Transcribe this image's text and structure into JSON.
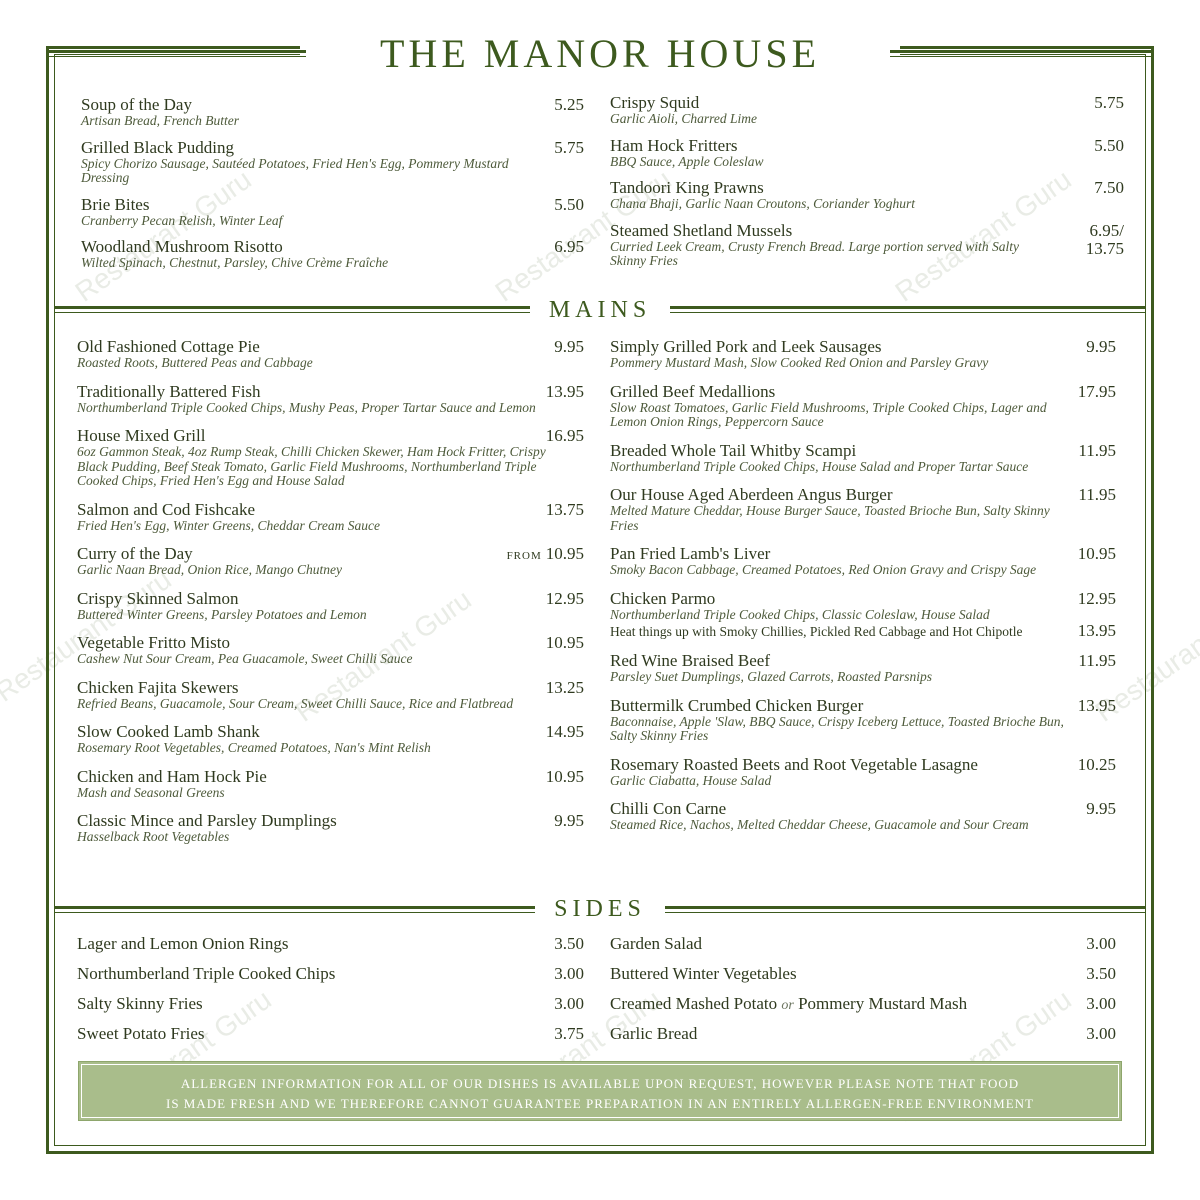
{
  "title": "THE MANOR HOUSE",
  "watermark": "Restaurant Guru",
  "colors": {
    "accent": "#3d5a1e",
    "banner": "#a9bd8b"
  },
  "starters_left": [
    {
      "name": "Soup of the Day",
      "desc": "Artisan Bread, French Butter",
      "price": "5.25"
    },
    {
      "name": "Grilled Black Pudding",
      "desc": "Spicy Chorizo Sausage, Sautéed Potatoes, Fried Hen's Egg, Pommery Mustard Dressing",
      "price": "5.75"
    },
    {
      "name": "Brie Bites",
      "desc": "Cranberry Pecan Relish, Winter Leaf",
      "price": "5.50"
    },
    {
      "name": "Woodland Mushroom Risotto",
      "desc": "Wilted Spinach, Chestnut, Parsley, Chive Crème Fraîche",
      "price": "6.95"
    }
  ],
  "starters_right": [
    {
      "name": "Crispy Squid",
      "desc": "Garlic Aioli, Charred Lime",
      "price": "5.75"
    },
    {
      "name": "Ham Hock Fritters",
      "desc": "BBQ Sauce, Apple Coleslaw",
      "price": "5.50"
    },
    {
      "name": "Tandoori King Prawns",
      "desc": "Chana Bhaji, Garlic Naan Croutons, Coriander Yoghurt",
      "price": "7.50"
    },
    {
      "name": "Steamed Shetland Mussels",
      "desc": "Curried Leek Cream, Crusty French Bread. Large portion served with Salty Skinny Fries",
      "price": "6.95/ 13.75"
    }
  ],
  "mains_heading": "MAINS",
  "mains_left": [
    {
      "name": "Old Fashioned Cottage Pie",
      "desc": "Roasted Roots, Buttered Peas and Cabbage",
      "price": "9.95"
    },
    {
      "name": "Traditionally Battered Fish",
      "desc": "Northumberland Triple Cooked Chips, Mushy Peas, Proper Tartar Sauce and Lemon",
      "price": "13.95"
    },
    {
      "name": "House Mixed Grill",
      "desc": "6oz Gammon Steak, 4oz Rump Steak, Chilli Chicken Skewer, Ham Hock Fritter, Crispy Black Pudding, Beef Steak Tomato, Garlic Field Mushrooms, Northumberland Triple Cooked Chips, Fried Hen's Egg and House Salad",
      "price": "16.95"
    },
    {
      "name": "Salmon and Cod Fishcake",
      "desc": "Fried Hen's Egg, Winter Greens, Cheddar Cream Sauce",
      "price": "13.75"
    },
    {
      "name": "Curry of the Day",
      "desc": "Garlic Naan Bread, Onion Rice, Mango Chutney",
      "price": "10.95",
      "prefix": "FROM"
    },
    {
      "name": "Crispy Skinned Salmon",
      "desc": "Buttered Winter Greens, Parsley Potatoes and Lemon",
      "price": "12.95"
    },
    {
      "name": "Vegetable Fritto Misto",
      "desc": "Cashew Nut Sour Cream, Pea Guacamole, Sweet Chilli Sauce",
      "price": "10.95"
    },
    {
      "name": "Chicken Fajita Skewers",
      "desc": "Refried Beans, Guacamole, Sour Cream, Sweet Chilli Sauce, Rice and Flatbread",
      "price": "13.25"
    },
    {
      "name": "Slow Cooked Lamb Shank",
      "desc": "Rosemary Root Vegetables, Creamed Potatoes, Nan's Mint Relish",
      "price": "14.95"
    },
    {
      "name": "Chicken and Ham Hock Pie",
      "desc": "Mash and Seasonal Greens",
      "price": "10.95"
    },
    {
      "name": "Classic Mince and Parsley Dumplings",
      "desc": "Hasselback Root Vegetables",
      "price": "9.95"
    }
  ],
  "mains_right": [
    {
      "name": "Simply Grilled Pork and Leek Sausages",
      "desc": "Pommery Mustard Mash, Slow Cooked Red Onion and Parsley Gravy",
      "price": "9.95"
    },
    {
      "name": "Grilled Beef Medallions",
      "desc": "Slow Roast Tomatoes, Garlic Field Mushrooms, Triple Cooked Chips, Lager and Lemon Onion Rings, Peppercorn Sauce",
      "price": "17.95"
    },
    {
      "name": "Breaded Whole Tail Whitby Scampi",
      "desc": "Northumberland Triple Cooked Chips, House Salad and Proper Tartar Sauce",
      "price": "11.95"
    },
    {
      "name": "Our House Aged Aberdeen Angus Burger",
      "desc": "Melted Mature Cheddar, House Burger Sauce, Toasted Brioche Bun, Salty Skinny Fries",
      "price": "11.95"
    },
    {
      "name": "Pan Fried Lamb's Liver",
      "desc": "Smoky Bacon Cabbage, Creamed Potatoes, Red Onion Gravy and Crispy Sage",
      "price": "10.95"
    },
    {
      "name": "Chicken Parmo",
      "desc": "Northumberland Triple Cooked Chips, Classic Coleslaw, House Salad",
      "price": "12.95",
      "extra": "Heat things up with Smoky Chillies, Pickled Red Cabbage and Hot Chipotle",
      "extra_price": "13.95"
    },
    {
      "name": "Red Wine Braised Beef",
      "desc": "Parsley Suet Dumplings, Glazed Carrots, Roasted Parsnips",
      "price": "11.95"
    },
    {
      "name": "Buttermilk Crumbed Chicken Burger",
      "desc": "Baconnaise, Apple 'Slaw, BBQ Sauce, Crispy Iceberg Lettuce, Toasted Brioche Bun, Salty Skinny Fries",
      "price": "13.95"
    },
    {
      "name": "Rosemary Roasted Beets and Root Vegetable Lasagne",
      "desc": "Garlic Ciabatta, House Salad",
      "price": "10.25"
    },
    {
      "name": "Chilli Con Carne",
      "desc": "Steamed Rice, Nachos, Melted Cheddar Cheese, Guacamole and Sour Cream",
      "price": "9.95"
    }
  ],
  "sides_heading": "SIDES",
  "sides_left": [
    {
      "name": "Lager and Lemon Onion Rings",
      "price": "3.50"
    },
    {
      "name": "Northumberland Triple Cooked Chips",
      "price": "3.00"
    },
    {
      "name": "Salty Skinny Fries",
      "price": "3.00"
    },
    {
      "name": "Sweet Potato Fries",
      "price": "3.75"
    }
  ],
  "sides_right": [
    {
      "name": "Garden Salad",
      "price": "3.00"
    },
    {
      "name": "Buttered Winter Vegetables",
      "price": "3.50"
    },
    {
      "name": "Creamed Mashed Potato",
      "or": "or",
      "name2": "Pommery Mustard Mash",
      "price": "3.00"
    },
    {
      "name": "Garlic Bread",
      "price": "3.00"
    }
  ],
  "allergen_line1": "ALLERGEN INFORMATION FOR ALL OF OUR DISHES IS AVAILABLE UPON REQUEST, HOWEVER PLEASE NOTE THAT FOOD",
  "allergen_line2": "IS MADE FRESH AND WE THEREFORE CANNOT GUARANTEE PREPARATION IN AN ENTIRELY ALLERGEN-FREE ENVIRONMENT"
}
